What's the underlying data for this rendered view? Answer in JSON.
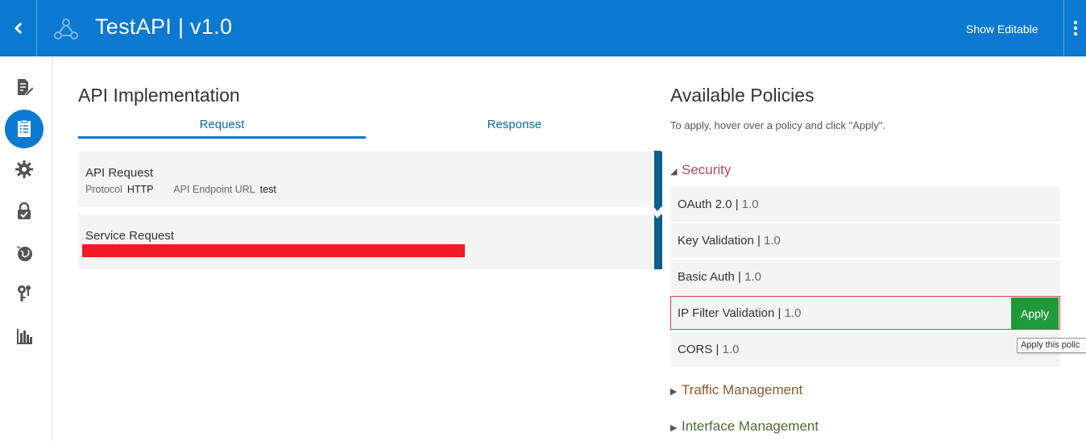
{
  "header": {
    "back_icon": "chevron-left-icon",
    "logo_icon": "api-network-icon",
    "title": "TestAPI | v1.0",
    "show_editable": "Show Editable",
    "menu_icon": "kebab-menu-icon",
    "bar_color": "#0b79d0"
  },
  "rail": {
    "items": [
      {
        "icon": "document-edit-icon",
        "active": false
      },
      {
        "icon": "api-implementation-icon",
        "active": true
      },
      {
        "icon": "gear-icon",
        "active": false
      },
      {
        "icon": "lock-icon",
        "active": false
      },
      {
        "icon": "globe-icon",
        "active": false
      },
      {
        "icon": "keys-icon",
        "active": false
      },
      {
        "icon": "bar-chart-icon",
        "active": false
      }
    ]
  },
  "implementation": {
    "title": "API Implementation",
    "tabs": [
      {
        "label": "Request",
        "selected": true
      },
      {
        "label": "Response",
        "selected": false
      }
    ],
    "api_request": {
      "title": "API Request",
      "protocol_label": "Protocol",
      "protocol_value": "HTTP",
      "endpoint_label": "API Endpoint URL",
      "endpoint_value": "test"
    },
    "service_request": {
      "title": "Service Request"
    }
  },
  "policies": {
    "title": "Available Policies",
    "hint": "To apply, hover over a policy and click \"Apply\".",
    "groups": [
      {
        "name": "Security",
        "expanded": true,
        "items": [
          {
            "name": "OAuth 2.0",
            "version": "1.0"
          },
          {
            "name": "Key Validation",
            "version": "1.0"
          },
          {
            "name": "Basic Auth",
            "version": "1.0"
          },
          {
            "name": "IP Filter Validation",
            "version": "1.0"
          },
          {
            "name": "CORS",
            "version": "1.0"
          }
        ]
      },
      {
        "name": "Traffic Management",
        "expanded": false
      },
      {
        "name": "Interface Management",
        "expanded": false
      }
    ],
    "apply_label": "Apply",
    "tooltip": "Apply this polic"
  }
}
